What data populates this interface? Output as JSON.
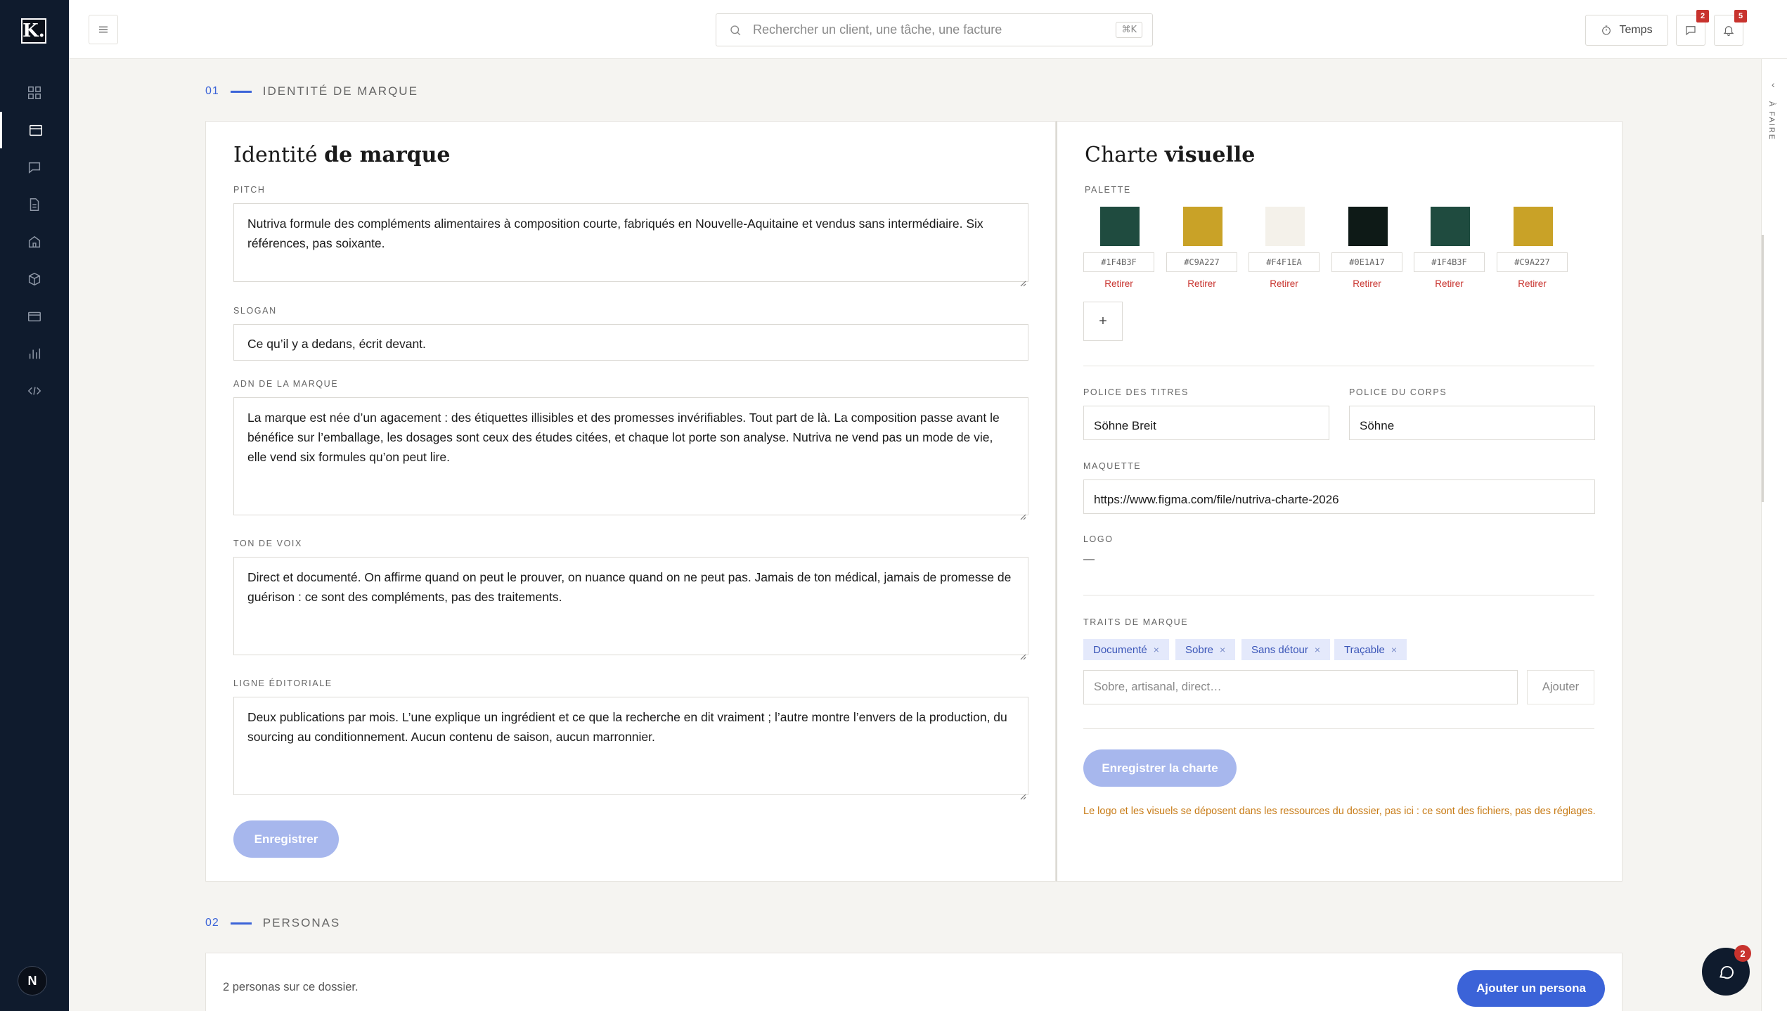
{
  "app": {
    "logo_letter": "K.",
    "avatar_letter": "N"
  },
  "search": {
    "placeholder": "Rechercher un client, une tâche, une facture",
    "shortcut": "⌘K"
  },
  "topbar": {
    "temps_label": "Temps",
    "messages_badge": "2",
    "notifications_badge": "5"
  },
  "rail": {
    "label": "À FAIRE"
  },
  "section1": {
    "number": "01",
    "title": "IDENTITÉ DE MARQUE"
  },
  "section2": {
    "number": "02",
    "title": "PERSONAS"
  },
  "identity": {
    "title_light": "Identité",
    "title_bold": "de marque",
    "pitch_label": "PITCH",
    "pitch_value": "Nutriva formule des compléments alimentaires à composition courte, fabriqués en Nouvelle-Aquitaine et vendus sans intermédiaire. Six références, pas soixante.",
    "slogan_label": "SLOGAN",
    "slogan_value": "Ce qu’il y a dedans, écrit devant.",
    "adn_label": "ADN DE LA MARQUE",
    "adn_value": "La marque est née d’un agacement : des étiquettes illisibles et des promesses invérifiables. Tout part de là. La composition passe avant le bénéfice sur l’emballage, les dosages sont ceux des études citées, et chaque lot porte son analyse. Nutriva ne vend pas un mode de vie, elle vend six formules qu’on peut lire.",
    "ton_label": "TON DE VOIX",
    "ton_value": "Direct et documenté. On affirme quand on peut le prouver, on nuance quand on ne peut pas. Jamais de ton médical, jamais de promesse de guérison : ce sont des compléments, pas des traitements.",
    "ligne_label": "LIGNE ÉDITORIALE",
    "ligne_value": "Deux publications par mois. L’une explique un ingrédient et ce que la recherche en dit vraiment ; l’autre montre l’envers de la production, du sourcing au conditionnement. Aucun contenu de saison, aucun marronnier.",
    "save_label": "Enregistrer"
  },
  "charte": {
    "title_light": "Charte",
    "title_bold": "visuelle",
    "palette_label": "PALETTE",
    "colors": [
      {
        "hex": "#1F4B3F",
        "remove": "Retirer"
      },
      {
        "hex": "#C9A227",
        "remove": "Retirer"
      },
      {
        "hex": "#F4F1EA",
        "remove": "Retirer"
      },
      {
        "hex": "#0E1A17",
        "remove": "Retirer"
      },
      {
        "hex": "#1F4B3F",
        "remove": "Retirer"
      },
      {
        "hex": "#C9A227",
        "remove": "Retirer"
      }
    ],
    "add_color": "+",
    "font_titles_label": "POLICE DES TITRES",
    "font_titles_value": "Söhne Breit",
    "font_body_label": "POLICE DU CORPS",
    "font_body_value": "Söhne",
    "maquette_label": "MAQUETTE",
    "maquette_value": "https://www.figma.com/file/nutriva-charte-2026",
    "logo_label": "LOGO",
    "logo_value": "—",
    "traits_label": "TRAITS DE MARQUE",
    "traits": [
      "Documenté",
      "Sobre",
      "Sans détour",
      "Traçable"
    ],
    "trait_remove": "×",
    "trait_placeholder": "Sobre, artisanal, direct…",
    "trait_add_label": "Ajouter",
    "save_label": "Enregistrer la charte",
    "note": "Le logo et les visuels se déposent dans les ressources du dossier, pas ici : ce sont des fichiers, pas des réglages."
  },
  "personas": {
    "count_text": "2 personas sur ce dossier.",
    "add_label": "Ajouter un persona"
  },
  "chat": {
    "badge": "2"
  },
  "colors": {
    "sidebar": "#0f1b2d",
    "accent": "#3b63d8",
    "danger": "#c8332e",
    "warning_text": "#c77a14"
  }
}
